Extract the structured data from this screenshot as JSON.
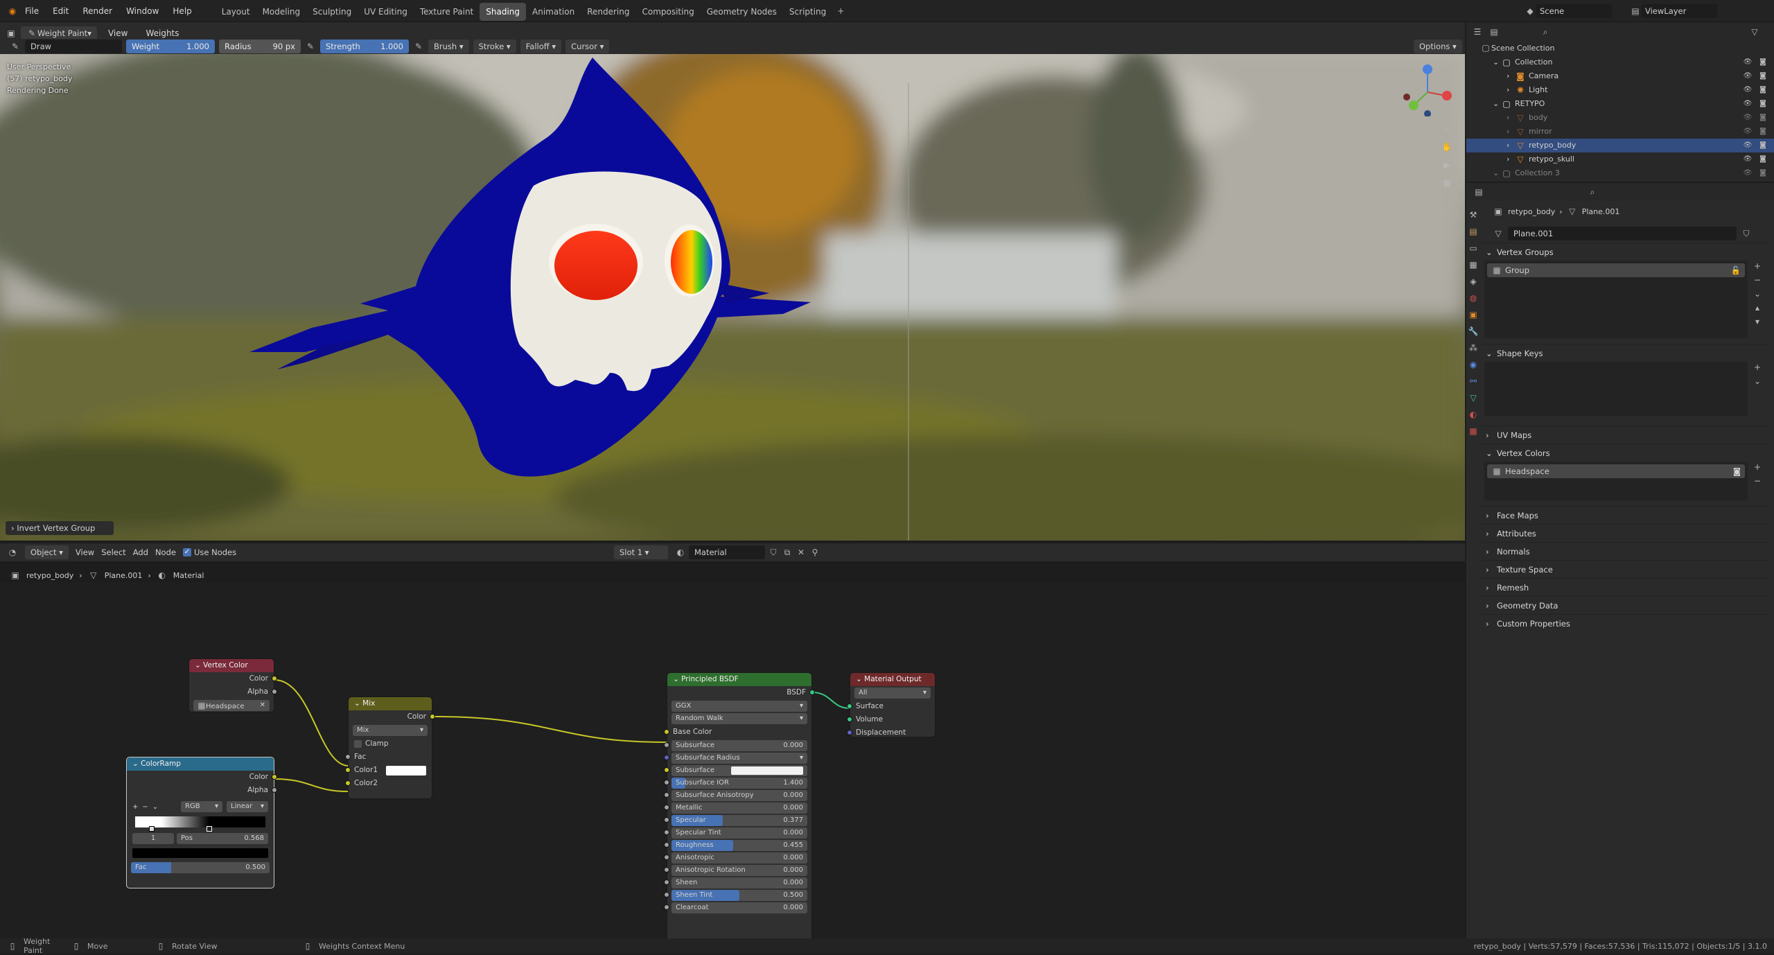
{
  "menu": {
    "items": [
      "File",
      "Edit",
      "Render",
      "Window",
      "Help"
    ]
  },
  "workspaces": [
    "Layout",
    "Modeling",
    "Sculpting",
    "UV Editing",
    "Texture Paint",
    "Shading",
    "Animation",
    "Rendering",
    "Compositing",
    "Geometry Nodes",
    "Scripting"
  ],
  "active_workspace": "Shading",
  "scene": {
    "label": "Scene",
    "view_layer": "ViewLayer"
  },
  "tool_header": {
    "mode": "Weight Paint",
    "view": "View",
    "weights": "Weights",
    "brush_name": "Draw",
    "weight_label": "Weight",
    "weight_value": "1.000",
    "radius_label": "Radius",
    "radius_value": "90 px",
    "strength_label": "Strength",
    "strength_value": "1.000",
    "brush": "Brush",
    "stroke": "Stroke",
    "falloff": "Falloff",
    "cursor": "Cursor",
    "options": "Options"
  },
  "viewport": {
    "overlay_line1": "User Perspective",
    "overlay_line2": "(57) retypo_body",
    "overlay_line3": "Rendering Done",
    "last_op": "Invert Vertex Group"
  },
  "node_header": {
    "mode": "Object",
    "view": "View",
    "select": "Select",
    "add": "Add",
    "node": "Node",
    "use_nodes": "Use Nodes",
    "slot": "Slot 1",
    "material": "Material"
  },
  "breadcrumb": {
    "object": "retypo_body",
    "mesh": "Plane.001",
    "material": "Material"
  },
  "nodes": {
    "vertex_color": {
      "title": "Vertex Color",
      "out_color": "Color",
      "out_alpha": "Alpha",
      "layer": "Headspace"
    },
    "mix": {
      "title": "Mix",
      "out_color": "Color",
      "blend": "Mix",
      "clamp": "Clamp",
      "fac": "Fac",
      "color1": "Color1",
      "color2": "Color2"
    },
    "colorramp": {
      "title": "ColorRamp",
      "out_color": "Color",
      "out_alpha": "Alpha",
      "mode": "RGB",
      "interp": "Linear",
      "index": "1",
      "pos_label": "Pos",
      "pos_value": "0.568",
      "fac_label": "Fac",
      "fac_value": "0.500",
      "fac_fraction": 0.5
    },
    "principled": {
      "title": "Principled BSDF",
      "out": "BSDF",
      "distribution": "GGX",
      "sss_method": "Random Walk",
      "base_color": "Base Color",
      "rows": [
        {
          "label": "Subsurface",
          "value": "0.000",
          "fill": 0
        },
        {
          "label": "Subsurface Radius",
          "value": "",
          "fill": 0,
          "dropdown": true
        },
        {
          "label": "Subsurface Col...",
          "value": "",
          "fill": 0,
          "color": true
        },
        {
          "label": "Subsurface IOR",
          "value": "1.400",
          "fill": 0.1
        },
        {
          "label": "Subsurface Anisotropy",
          "value": "0.000",
          "fill": 0
        },
        {
          "label": "Metallic",
          "value": "0.000",
          "fill": 0
        },
        {
          "label": "Specular",
          "value": "0.377",
          "fill": 0.377
        },
        {
          "label": "Specular Tint",
          "value": "0.000",
          "fill": 0
        },
        {
          "label": "Roughness",
          "value": "0.455",
          "fill": 0.455
        },
        {
          "label": "Anisotropic",
          "value": "0.000",
          "fill": 0
        },
        {
          "label": "Anisotropic Rotation",
          "value": "0.000",
          "fill": 0
        },
        {
          "label": "Sheen",
          "value": "0.000",
          "fill": 0
        },
        {
          "label": "Sheen Tint",
          "value": "0.500",
          "fill": 0.5
        },
        {
          "label": "Clearcoat",
          "value": "0.000",
          "fill": 0
        }
      ]
    },
    "output": {
      "title": "Material Output",
      "target": "All",
      "surface": "Surface",
      "volume": "Volume",
      "displacement": "Displacement"
    }
  },
  "outliner": {
    "root": "Scene Collection",
    "items": [
      {
        "label": "Collection",
        "indent": 1,
        "type": "collection"
      },
      {
        "label": "Camera",
        "indent": 2,
        "type": "camera"
      },
      {
        "label": "Light",
        "indent": 2,
        "type": "light"
      },
      {
        "label": "RETYPO",
        "indent": 1,
        "type": "collection"
      },
      {
        "label": "body",
        "indent": 2,
        "type": "mesh",
        "dim": true
      },
      {
        "label": "mirror",
        "indent": 2,
        "type": "mesh",
        "dim": true
      },
      {
        "label": "retypo_body",
        "indent": 2,
        "type": "mesh",
        "selected": true
      },
      {
        "label": "retypo_skull",
        "indent": 2,
        "type": "mesh"
      },
      {
        "label": "Collection 3",
        "indent": 1,
        "type": "collection",
        "dim": true
      }
    ]
  },
  "properties": {
    "object": "retypo_body",
    "mesh": "Plane.001",
    "mesh_field": "Plane.001",
    "vertex_groups": "Vertex Groups",
    "group_item": "Group",
    "shape_keys": "Shape Keys",
    "uv_maps": "UV Maps",
    "vertex_colors": "Vertex Colors",
    "vc_item": "Headspace",
    "collapsed": [
      "Face Maps",
      "Attributes",
      "Normals",
      "Texture Space",
      "Remesh",
      "Geometry Data",
      "Custom Properties"
    ]
  },
  "statusbar": {
    "mode": "Weight Paint",
    "move": "Move",
    "rotate": "Rotate View",
    "context": "Weights Context Menu",
    "stats": "retypo_body | Verts:57,579 | Faces:57,536 | Tris:115,072 | Objects:1/5 | 3.1.0"
  },
  "colors": {
    "accent": "#4772b3",
    "vc_header": "#7a2a3a",
    "mix_header": "#5e5e1c",
    "ramp_header": "#2a6a8a",
    "bsdf_header": "#2e6e2e",
    "out_header": "#6e2a2a"
  }
}
